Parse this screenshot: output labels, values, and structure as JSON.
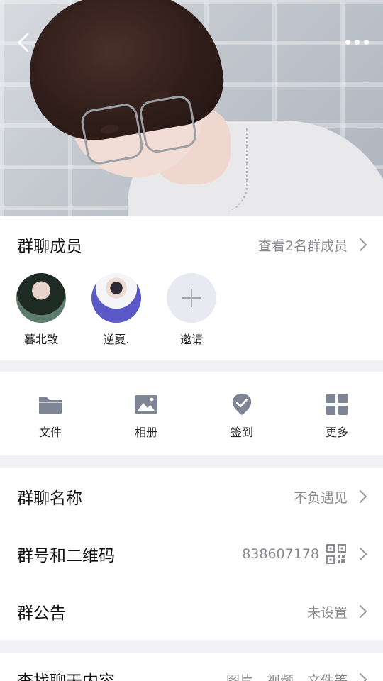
{
  "header": {
    "back_icon": "chevron-left-icon",
    "more_icon": "more-dots-icon"
  },
  "members": {
    "title": "群聊成员",
    "view_all": "查看2名群成员",
    "list": [
      {
        "name": "暮北致"
      },
      {
        "name": "逆夏."
      },
      {
        "name": "邀请"
      }
    ]
  },
  "tools": [
    {
      "label": "文件",
      "icon": "folder-icon"
    },
    {
      "label": "相册",
      "icon": "image-icon"
    },
    {
      "label": "签到",
      "icon": "checkin-icon"
    },
    {
      "label": "更多",
      "icon": "grid-icon"
    }
  ],
  "settings": {
    "group_name": {
      "title": "群聊名称",
      "value": "不负遇见"
    },
    "group_id": {
      "title": "群号和二维码",
      "value": "838607178",
      "icon": "qr-code-icon"
    },
    "announcement": {
      "title": "群公告",
      "value": "未设置"
    }
  },
  "search": {
    "title": "查找聊天内容",
    "value": "图片、视频、文件等"
  },
  "colors": {
    "background": "#f1f1f5",
    "card": "#ffffff",
    "text_primary": "#111111",
    "text_secondary": "#8a8a92",
    "icon": "#7e8696"
  }
}
